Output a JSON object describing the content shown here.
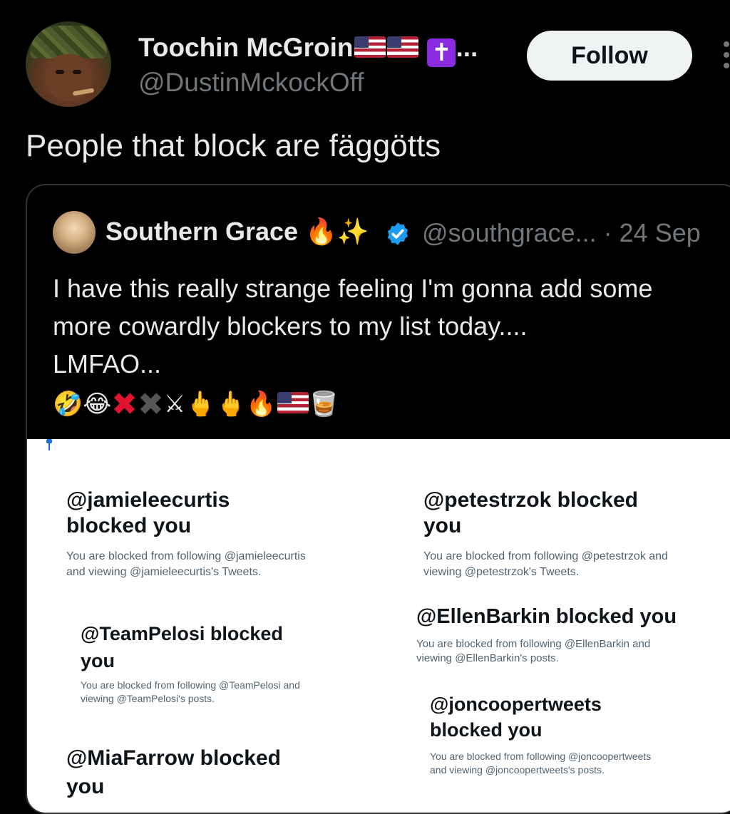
{
  "author": {
    "display_name": "Toochin McGroin",
    "name_suffix": "...",
    "username": "@DustinMckockOff"
  },
  "follow_label": "Follow",
  "tweet_text": "People that block are fäggötts",
  "quote": {
    "name": "Southern Grace",
    "name_emojis": "🔥✨",
    "handle_date": "@southgrace... · 24 Sep",
    "lines": [
      "I have this really strange feeling I'm gonna add some",
      "more cowardly blockers to my list today....",
      "LMFAO..."
    ],
    "emoji_a": "🤣😂",
    "emoji_b": "⚔🖕🖕🔥",
    "emoji_c": "🥃",
    "cards": [
      {
        "title1": "@jamieleecurtis",
        "title2": "blocked you",
        "desc1": "You are blocked from following @jamieleecurtis",
        "desc2": "and viewing @jamieleecurtis's Tweets."
      },
      {
        "title1": "@petestrzok blocked",
        "title2": "you",
        "desc1": "You are blocked from following @petestrzok and",
        "desc2": "viewing @petestrzok's Tweets."
      },
      {
        "title1": "@EllenBarkin blocked you",
        "desc1": "You are blocked from following @EllenBarkin and",
        "desc2": "viewing @EllenBarkin's posts."
      },
      {
        "title1": "@TeamPelosi blocked",
        "title2": "you",
        "desc1": "You are blocked from following @TeamPelosi and",
        "desc2": "viewing @TeamPelosi's posts."
      },
      {
        "title1": "@joncoopertweets",
        "title2": "blocked you",
        "desc1": "You are blocked from following @joncoopertweets",
        "desc2": "and viewing @joncoopertweets's posts."
      },
      {
        "title1": "@MiaFarrow blocked",
        "title2": "you"
      }
    ]
  },
  "colors": {
    "verified": "#1d9bf0",
    "follow_bg": "#eff3f4",
    "muted": "#71767b"
  }
}
